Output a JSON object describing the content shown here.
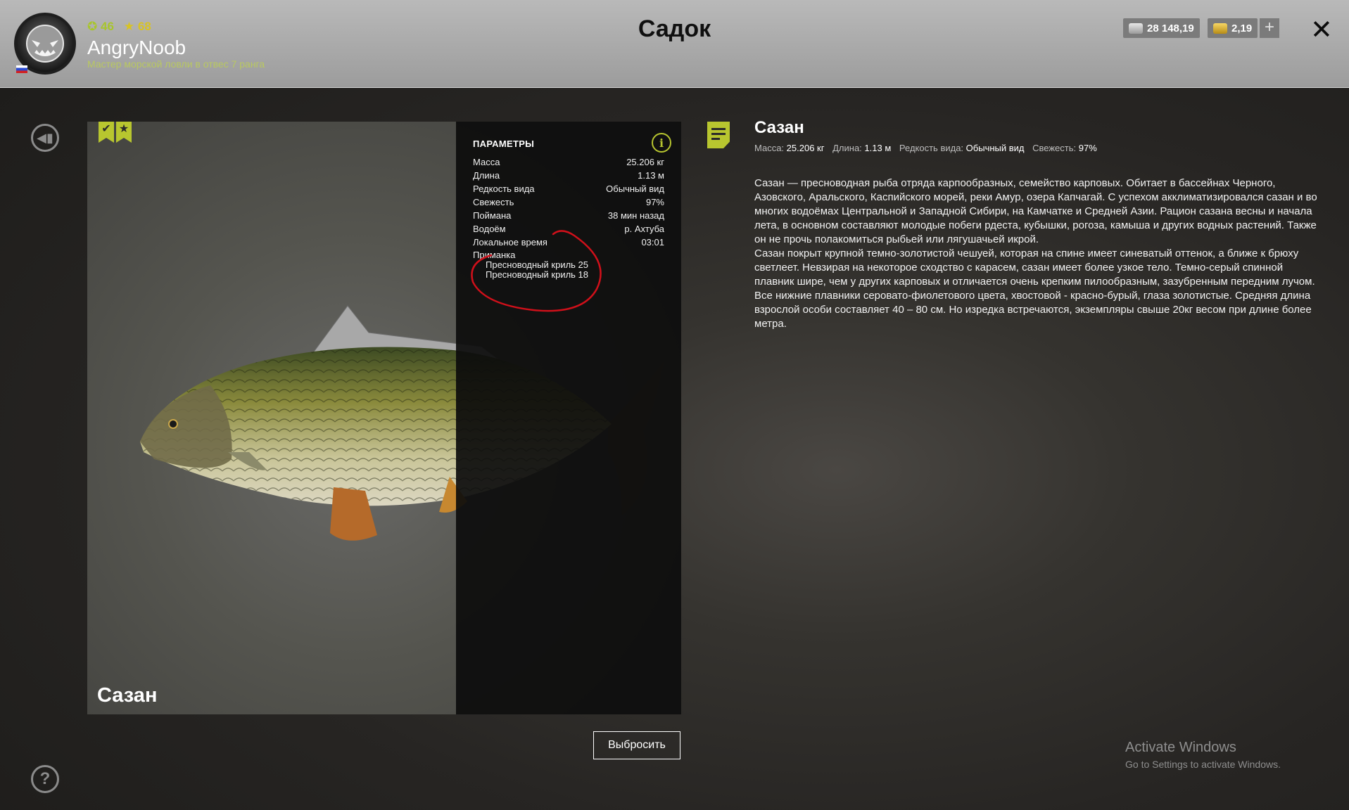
{
  "header": {
    "title": "Садок",
    "player": {
      "level": "46",
      "stars": "68",
      "name": "AngryNoob",
      "rank": "Мастер морской ловли в отвес 7 ранга"
    },
    "currency": {
      "silver": "28 148,19",
      "gold": "2,19"
    },
    "close_label": "✕",
    "plus_label": "+"
  },
  "fish": {
    "name": "Сазан",
    "caption": "Сазан",
    "badges": [
      "✔",
      "★"
    ],
    "params_title": "ПАРАМЕТРЫ",
    "params": [
      {
        "label": "Масса",
        "value": "25.206 кг"
      },
      {
        "label": "Длина",
        "value": "1.13 м"
      },
      {
        "label": "Редкость вида",
        "value": "Обычный вид"
      },
      {
        "label": "Свежесть",
        "value": "97%"
      },
      {
        "label": "Поймана",
        "value": "38 мин назад"
      },
      {
        "label": "Водоём",
        "value": "р. Ахтуба"
      },
      {
        "label": "Локальное время",
        "value": "03:01"
      }
    ],
    "bait_label": "Приманка",
    "baits": [
      "Пресноводный криль 25",
      "Пресноводный криль 18"
    ]
  },
  "details": {
    "meta": {
      "mass_label": "Масса:",
      "mass": "25.206 кг",
      "length_label": "Длина:",
      "length": "1.13 м",
      "rarity_label": "Редкость вида:",
      "rarity": "Обычный вид",
      "fresh_label": "Свежесть:",
      "fresh": "97%"
    },
    "description": [
      "Сазан — пресноводная рыба отряда карпообразных, семейство карповых. Обитает в бассейнах Черного, Азовского, Аральского, Каспийского морей, реки Амур, озера Капчагай. С успехом акклиматизировался сазан и во многих водоёмах Центральной и Западной Сибири, на Камчатке и Средней Азии. Рацион сазана весны и начала лета, в основном составляют молодые побеги рдеста, кубышки, рогоза, камыша и других водных растений. Также он не прочь полакомиться рыбьей или лягушачьей икрой.",
      "Сазан покрыт крупной темно-золотистой чешуей, которая на спине имеет синеватый оттенок, а ближе к брюху светлеет. Невзирая на некоторое сходство с карасем, сазан имеет более узкое тело. Темно-серый спинной плавник шире, чем у других карповых и отличается очень крепким пилообразным, зазубренным передним лучом. Все нижние плавники серовато-фиолетового цвета, хвостовой - красно-бурый, глаза золотистые. Средняя длина взрослой особи составляет 40 – 80 см. Но изредка встречаются, экземпляры свыше 20кг весом при длине более метра."
    ]
  },
  "actions": {
    "release": "Выбросить"
  },
  "watermark": {
    "line1": "Activate Windows",
    "line2": "Go to Settings to activate Windows."
  },
  "colors": {
    "accent": "#b8c62f",
    "header_bg": "#a9a9a9",
    "annotation_red": "#d0101a"
  },
  "icons": [
    "avatar",
    "flag-ru",
    "level-icon",
    "star-icon",
    "silver-coin-icon",
    "gold-coin-icon",
    "plus-icon",
    "close-icon",
    "back-icon",
    "help-icon",
    "checkmark-badge-icon",
    "star-badge-icon",
    "info-icon",
    "notes-icon"
  ]
}
